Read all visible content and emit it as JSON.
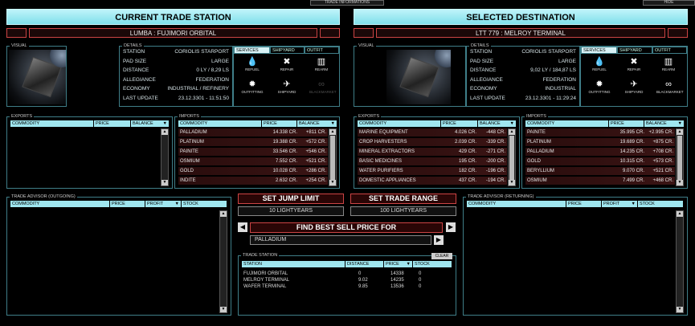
{
  "top": {
    "info_tab": "TRADE INFORMATIONS",
    "hide": "HIDE"
  },
  "left": {
    "header": "CURRENT TRADE STATION",
    "station_name": "LUMBA : FUJIMORI ORBITAL",
    "visual_label": "VISUAL",
    "details_label": "DETAILS",
    "details": [
      {
        "k": "STATION",
        "v": "CORIOLIS STARPORT"
      },
      {
        "k": "PAD SIZE",
        "v": "LARGE"
      },
      {
        "k": "DISTANCE",
        "v": "0 LY / 8,29 LS"
      },
      {
        "k": "ALLEGIANCE",
        "v": "FEDERATION"
      },
      {
        "k": "ECONOMY",
        "v": "INDUSTRIAL / REFINERY"
      },
      {
        "k": "LAST UPDATE",
        "v": "23.12.3301 - 11:51:50"
      }
    ],
    "tabs": [
      "SERVICES",
      "SHIPYARD",
      "OUTFIT"
    ],
    "services": [
      {
        "icon": "fuel-drop-icon",
        "glyph": "💧",
        "label": "REFUEL",
        "on": true
      },
      {
        "icon": "wrench-icon",
        "glyph": "✖",
        "label": "REPAIR",
        "on": true
      },
      {
        "icon": "ammo-icon",
        "glyph": "▥",
        "label": "REARM",
        "on": true
      },
      {
        "icon": "gear-icon",
        "glyph": "✹",
        "label": "OUTFITTING",
        "on": true
      },
      {
        "icon": "ship-icon",
        "glyph": "✈",
        "label": "SHIPYARD",
        "on": true
      },
      {
        "icon": "glasses-icon",
        "glyph": "∞",
        "label": "BLACKMARKET",
        "on": false
      }
    ],
    "exports_label": "EXPORTS",
    "exports_cols": [
      "COMMODITY",
      "PRICE",
      "BALANCE"
    ],
    "exports": [],
    "imports_label": "IMPORTS",
    "imports_cols": [
      "COMMODITY",
      "PRICE",
      "BALANCE"
    ],
    "imports": [
      {
        "c": "PALLADIUM",
        "p": "14.338 CR.",
        "b": "+811 CR."
      },
      {
        "c": "PLATINUM",
        "p": "19.388 CR.",
        "b": "+572 CR."
      },
      {
        "c": "PAINITE",
        "p": "33.546 CR.",
        "b": "+546 CR."
      },
      {
        "c": "OSMIUM",
        "p": "7.552 CR.",
        "b": "+521 CR."
      },
      {
        "c": "GOLD",
        "p": "10.028 CR.",
        "b": "+286 CR."
      },
      {
        "c": "INDITE",
        "p": "2.632 CR.",
        "b": "+254 CR."
      }
    ],
    "advisor_label": "TRADE ADVISOR (OUTGOING)",
    "advisor_cols": [
      "COMMODITY",
      "PRICE",
      "PROFIT",
      "STOCK"
    ]
  },
  "right": {
    "header": "SELECTED DESTINATION",
    "station_name": "LTT 779 : MELROY TERMINAL",
    "visual_label": "VISUAL",
    "details_label": "DETAILS",
    "details": [
      {
        "k": "STATION",
        "v": "CORIOLIS STARPORT"
      },
      {
        "k": "PAD SIZE",
        "v": "LARGE"
      },
      {
        "k": "DISTANCE",
        "v": "9,02 LY / 184,87 LS"
      },
      {
        "k": "ALLEGIANCE",
        "v": "FEDERATION"
      },
      {
        "k": "ECONOMY",
        "v": "INDUSTRIAL"
      },
      {
        "k": "LAST UPDATE",
        "v": "23.12.3301 - 11:29:24"
      }
    ],
    "tabs": [
      "SERVICES",
      "SHIPYARD",
      "OUTFIT"
    ],
    "services": [
      {
        "icon": "fuel-drop-icon",
        "glyph": "💧",
        "label": "REFUEL",
        "on": true
      },
      {
        "icon": "wrench-icon",
        "glyph": "✖",
        "label": "REPAIR",
        "on": true
      },
      {
        "icon": "ammo-icon",
        "glyph": "▥",
        "label": "REARM",
        "on": true
      },
      {
        "icon": "gear-icon",
        "glyph": "✹",
        "label": "OUTFITTING",
        "on": true
      },
      {
        "icon": "ship-icon",
        "glyph": "✈",
        "label": "SHIPYARD",
        "on": true
      },
      {
        "icon": "glasses-icon",
        "glyph": "∞",
        "label": "BLACKMARKET",
        "on": true
      }
    ],
    "exports_label": "EXPORTS",
    "exports_cols": [
      "COMMODITY",
      "PRICE",
      "BALANCE"
    ],
    "exports": [
      {
        "c": "MARINE EQUIPMENT",
        "p": "4.026 CR.",
        "b": "-448 CR."
      },
      {
        "c": "CROP HARVESTERS",
        "p": "2.039 CR.",
        "b": "-339 CR."
      },
      {
        "c": "MINERAL EXTRACTORS",
        "p": "429 CR.",
        "b": "-271 CR."
      },
      {
        "c": "BASIC MEDICINES",
        "p": "195 CR.",
        "b": "-200 CR."
      },
      {
        "c": "WATER PURIFIERS",
        "p": "182 CR.",
        "b": "-196 CR."
      },
      {
        "c": "DOMESTIC APPLIANCES",
        "p": "437 CR.",
        "b": "-194 CR."
      }
    ],
    "imports_label": "IMPORTS",
    "imports_cols": [
      "COMMODITY",
      "PRICE",
      "BALANCE"
    ],
    "imports": [
      {
        "c": "PAINITE",
        "p": "35.995 CR.",
        "b": "+2.995 CR."
      },
      {
        "c": "PLATINUM",
        "p": "19.689 CR.",
        "b": "+875 CR."
      },
      {
        "c": "PALLADIUM",
        "p": "14.235 CR.",
        "b": "+708 CR."
      },
      {
        "c": "GOLD",
        "p": "10.315 CR.",
        "b": "+573 CR."
      },
      {
        "c": "BERYLLIUM",
        "p": "9.070 CR.",
        "b": "+521 CR."
      },
      {
        "c": "OSMIUM",
        "p": "7.499 CR.",
        "b": "+468 CR."
      }
    ],
    "advisor_label": "TRADE ADVISOR (RETURNING)",
    "advisor_cols": [
      "COMMODITY",
      "PRICE",
      "PROFIT",
      "STOCK"
    ]
  },
  "center": {
    "jump_btn": "SET JUMP LIMIT",
    "jump_val": "10 LIGHTYEARS",
    "range_btn": "SET TRADE RANGE",
    "range_val": "100 LIGHTYEARS",
    "find_btn": "FIND BEST SELL PRICE FOR",
    "commodity": "PALLADIUM",
    "station_label": "TRADE STATION",
    "clear": "CLEAR",
    "cols": [
      "STATION",
      "DISTANCE",
      "PRICE",
      "STOCK"
    ],
    "rows": [
      {
        "s": "FUJIMORI ORBITAL",
        "d": "0",
        "p": "14338",
        "k": "0"
      },
      {
        "s": "MELROY TERMINAL",
        "d": "9.02",
        "p": "14235",
        "k": "0"
      },
      {
        "s": "WAFER TERMINAL",
        "d": "9.85",
        "p": "13536",
        "k": "0"
      }
    ]
  }
}
